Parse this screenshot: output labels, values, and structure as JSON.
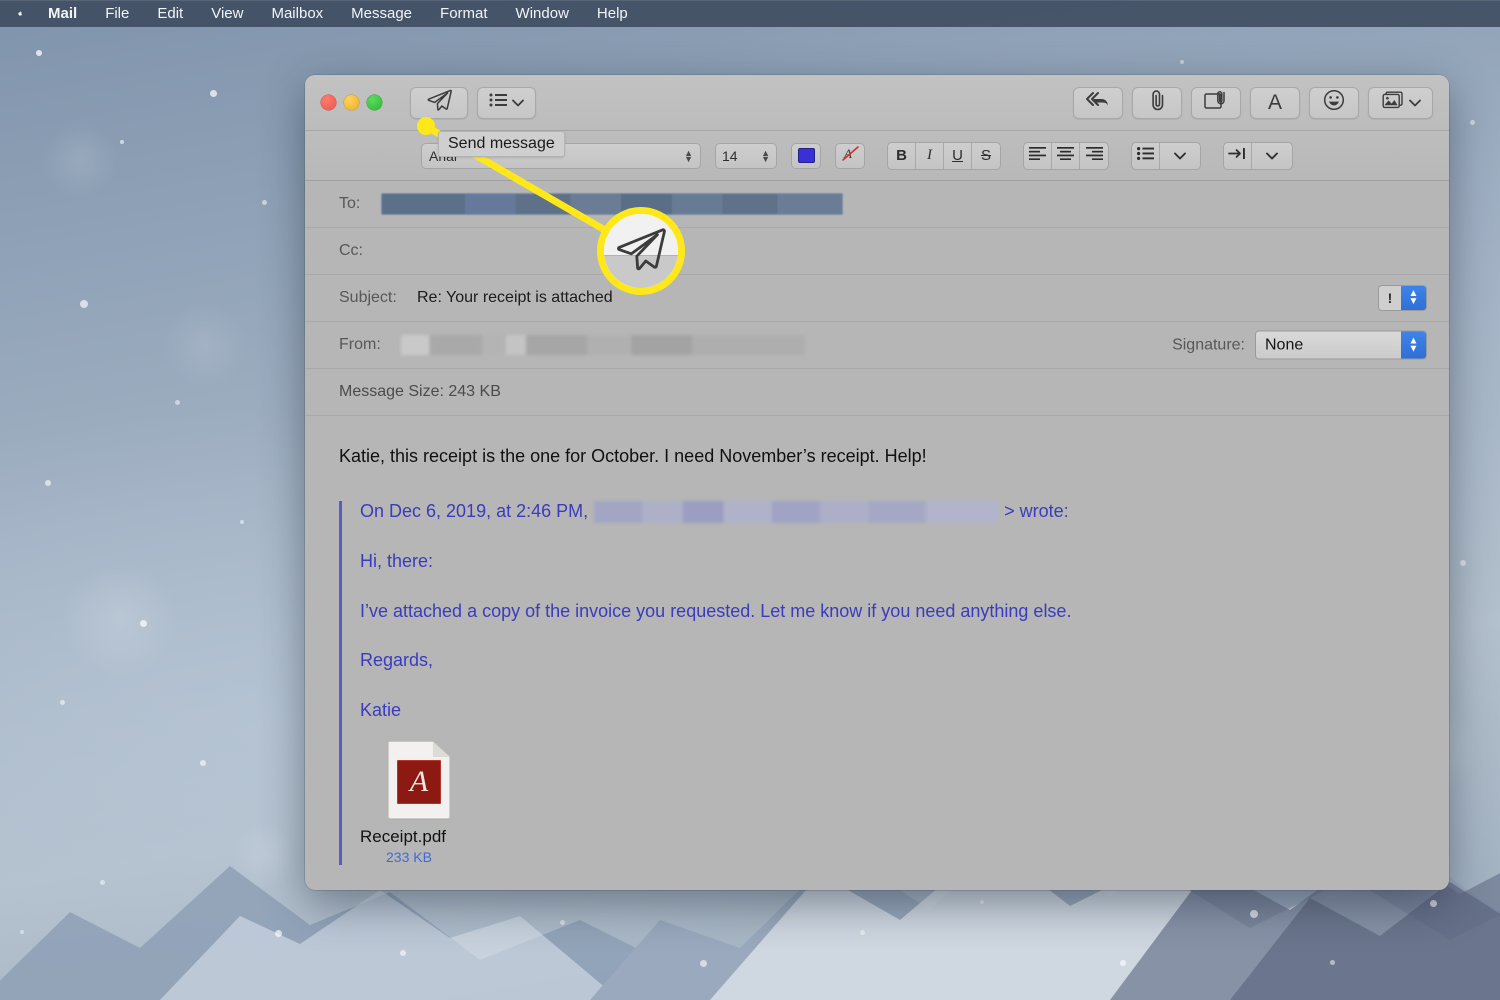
{
  "menubar": {
    "apple_icon": "apple-logo-icon",
    "items": [
      {
        "label": "Mail",
        "bold": true
      },
      {
        "label": "File",
        "bold": false
      },
      {
        "label": "Edit",
        "bold": false
      },
      {
        "label": "View",
        "bold": false
      },
      {
        "label": "Mailbox",
        "bold": false
      },
      {
        "label": "Message",
        "bold": false
      },
      {
        "label": "Format",
        "bold": false
      },
      {
        "label": "Window",
        "bold": false
      },
      {
        "label": "Help",
        "bold": false
      }
    ]
  },
  "window": {
    "traffic_lights": [
      "close-button",
      "minimize-button",
      "zoom-button"
    ]
  },
  "toolbar": {
    "send_icon": "paper-plane-icon",
    "header_fields_icon": "list-icon",
    "header_fields_chevron": "chevron-down-icon",
    "reply_all_icon": "reply-all-arrow-icon",
    "attach_icon": "paperclip-icon",
    "attach_document_icon": "document-attachment-icon",
    "format_icon": "letter-a-icon",
    "emoji_icon": "smiley-face-icon",
    "photos_icon": "photo-browser-icon",
    "photos_chevron": "chevron-down-icon"
  },
  "formatbar": {
    "font_name": "Arial",
    "font_size": "14",
    "text_color": "#3a30d8",
    "clear_format_icon": "clear-formatting-icon",
    "bold_label": "B",
    "italic_label": "I",
    "underline_label": "U",
    "strikethrough_label": "S",
    "align_left_icon": "align-left-icon",
    "align_center_icon": "align-center-icon",
    "align_right_icon": "align-right-icon",
    "list_icon": "bulleted-list-icon",
    "list_chevron": "chevron-down-icon",
    "indent_icon": "indent-icon",
    "indent_chevron": "chevron-down-icon"
  },
  "headers": {
    "to_label": "To:",
    "to_value": "",
    "cc_label": "Cc:",
    "cc_value": "",
    "subject_label": "Subject:",
    "subject_value": "Re: Your receipt is attached",
    "priority_label": "!",
    "from_label": "From:",
    "from_value": "",
    "signature_label": "Signature:",
    "signature_value": "None",
    "message_size": "Message Size: 243 KB"
  },
  "message": {
    "body": "Katie, this receipt is the one for October. I need November’s receipt. Help!",
    "quote_intro_prefix": "On Dec 6, 2019, at 2:46 PM,",
    "quote_intro_suffix": "> wrote:",
    "quote_lines": [
      "Hi, there:",
      "I’ve attached a copy of the invoice you requested. Let me know if you need anything else.",
      "Regards,",
      "Katie"
    ],
    "attachment": {
      "icon": "pdf-file-icon",
      "badge_glyph": "A",
      "name": "Receipt.pdf",
      "size": "233 KB"
    }
  },
  "callout": {
    "tooltip_text": "Send message",
    "magnified_icon": "paper-plane-icon",
    "highlight_color": "#ffe81a"
  }
}
